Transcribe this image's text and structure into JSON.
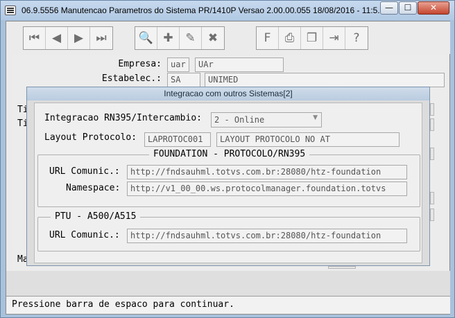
{
  "window": {
    "title": "06.9.5556 Manutencao  Parametros do Sistema PR/1410P Versao 2.00.00.055 18/08/2016 - 11:5...",
    "controls": {
      "minimize": "—",
      "maximize": "☐",
      "close": "✕"
    }
  },
  "toolbar": {
    "nav": [
      {
        "icon": "first-record-icon",
        "glyph": "⏮"
      },
      {
        "icon": "previous-record-icon",
        "glyph": "◀"
      },
      {
        "icon": "next-record-icon",
        "glyph": "▶"
      },
      {
        "icon": "last-record-icon",
        "glyph": "⏭"
      }
    ],
    "edit": [
      {
        "icon": "go-to-icon",
        "glyph": "🔍"
      },
      {
        "icon": "add-record-icon",
        "glyph": "✚"
      },
      {
        "icon": "modify-record-icon",
        "glyph": "✎"
      },
      {
        "icon": "delete-record-icon",
        "glyph": "✖"
      }
    ],
    "misc": [
      {
        "icon": "filter-icon",
        "glyph": "F"
      },
      {
        "icon": "print-icon",
        "glyph": "⎙"
      },
      {
        "icon": "copy-icon",
        "glyph": "❐"
      },
      {
        "icon": "exit-icon",
        "glyph": "⇥"
      },
      {
        "icon": "help-icon",
        "glyph": "?"
      }
    ]
  },
  "background_form": {
    "empresa_label": "Empresa:",
    "empresa_code": "uar",
    "empresa_name": "UAr",
    "estabelec_label": "Estabelec.:",
    "estabelec_code": "SA",
    "estabelec_name": "UNIMED",
    "partial_labels": [
      "Ti",
      "Ti",
      "Ma"
    ]
  },
  "dialog": {
    "title": "Integracao com outros Sistemas[2]",
    "integracao_label": "Integracao RN395/Intercambio:",
    "integracao_value": "2 - Online",
    "layout_label": "Layout Protocolo:",
    "layout_code": "LAPROTOC001",
    "layout_desc": "LAYOUT PROTOCOLO NO AT",
    "foundation": {
      "title": "FOUNDATION - PROTOCOLO/RN395",
      "url_label": "URL Comunic.:",
      "url_value": "http://fndsauhml.totvs.com.br:28080/htz-foundation",
      "namespace_label": "Namespace:",
      "namespace_value": "http://v1_00_00.ws.protocolmanager.foundation.totvs"
    },
    "ptu": {
      "title": "PTU - A500/A515",
      "url_label": "URL Comunic.:",
      "url_value": "http://fndsauhml.totvs.com.br:28080/htz-foundation"
    }
  },
  "status": {
    "message": "Pressione barra de espaco para continuar."
  }
}
